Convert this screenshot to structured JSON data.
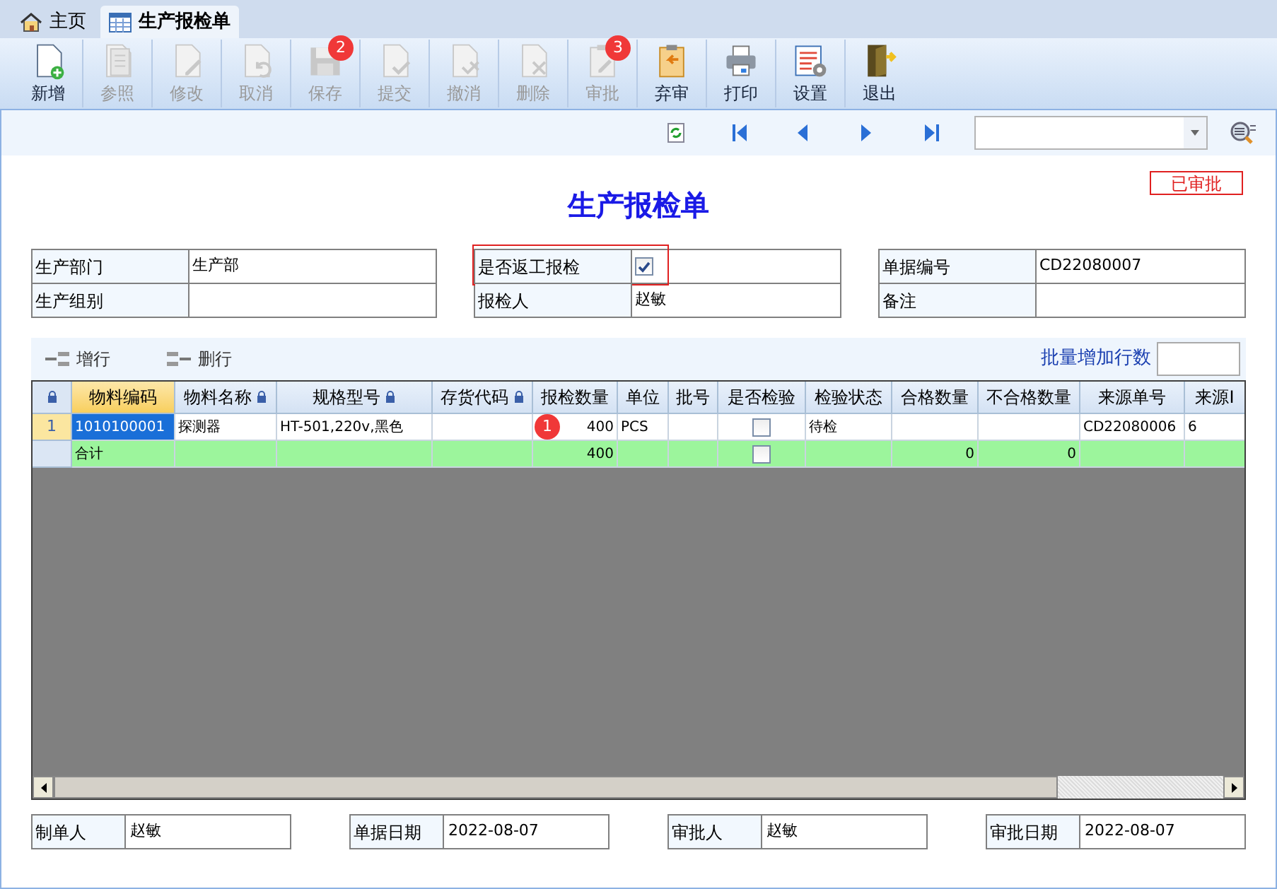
{
  "tabs": [
    {
      "label": "主页",
      "kind": "home",
      "selected": false
    },
    {
      "label": "生产报检单",
      "kind": "table",
      "selected": true
    }
  ],
  "toolbar": [
    {
      "label": "新增",
      "kind": "new",
      "disabled": false
    },
    {
      "label": "参照",
      "kind": "copy",
      "disabled": true
    },
    {
      "label": "修改",
      "kind": "edit",
      "disabled": true
    },
    {
      "label": "取消",
      "kind": "undo",
      "disabled": true
    },
    {
      "label": "保存",
      "kind": "save",
      "disabled": true,
      "badge": "2"
    },
    {
      "label": "提交",
      "kind": "check",
      "disabled": true
    },
    {
      "label": "撤消",
      "kind": "revoke",
      "disabled": true
    },
    {
      "label": "删除",
      "kind": "delete",
      "disabled": true
    },
    {
      "label": "审批",
      "kind": "approve",
      "disabled": true,
      "badge": "3"
    },
    {
      "label": "弃审",
      "kind": "abandon",
      "disabled": false
    },
    {
      "label": "打印",
      "kind": "print",
      "disabled": false
    },
    {
      "label": "设置",
      "kind": "settings",
      "disabled": false
    },
    {
      "label": "退出",
      "kind": "exit",
      "disabled": false
    }
  ],
  "title": "生产报检单",
  "status": "已审批",
  "header_groups": [
    [
      {
        "label": "生产部门",
        "value": "生产部",
        "kind": "text"
      },
      {
        "label": "生产组别",
        "kind": "text"
      }
    ],
    [
      {
        "label": "是否返工报检",
        "kind": "checkbox",
        "checked": true,
        "highlighted": true
      },
      {
        "label": "报检人",
        "value": "赵敏",
        "kind": "text"
      }
    ],
    [
      {
        "label": "单据编号",
        "value": "CD22080007",
        "kind": "text"
      },
      {
        "label": "备注",
        "kind": "text"
      }
    ]
  ],
  "grid_toolbar": {
    "actions": [
      {
        "label": "增行",
        "kind": "add"
      },
      {
        "label": "删行",
        "kind": "remove"
      }
    ],
    "batch_label": "批量增加行数"
  },
  "columns": [
    {
      "locked": true,
      "kind": "indicator"
    },
    {
      "label": "物料编码",
      "locked": false,
      "sorted": true,
      "kind": "text"
    },
    {
      "label": "物料名称",
      "locked": true,
      "sorted": false,
      "kind": "text"
    },
    {
      "label": "规格型号",
      "locked": true,
      "sorted": false,
      "kind": "text"
    },
    {
      "label": "存货代码",
      "locked": true,
      "sorted": false,
      "kind": "text"
    },
    {
      "label": "报检数量",
      "locked": false,
      "sorted": false,
      "kind": "number"
    },
    {
      "label": "单位",
      "locked": false,
      "sorted": false,
      "kind": "text"
    },
    {
      "label": "批号",
      "locked": false,
      "sorted": false,
      "kind": "text"
    },
    {
      "label": "是否检验",
      "locked": false,
      "sorted": false,
      "kind": "check"
    },
    {
      "label": "检验状态",
      "locked": false,
      "sorted": false,
      "kind": "text"
    },
    {
      "label": "合格数量",
      "locked": false,
      "sorted": false,
      "kind": "number"
    },
    {
      "label": "不合格数量",
      "locked": false,
      "sorted": false,
      "kind": "number"
    },
    {
      "label": "来源单号",
      "locked": false,
      "sorted": false,
      "kind": "text"
    },
    {
      "label": "来源I",
      "locked": false,
      "sorted": false,
      "kind": "text"
    }
  ],
  "rows": [
    {
      "kind": "data",
      "selected": true,
      "number": "1",
      "badge": "1",
      "inspected": false,
      "cells": [
        "1010100001",
        "探测器",
        "HT-501,220v,黑色",
        null,
        "400",
        "PCS",
        null,
        null,
        "待检",
        null,
        null,
        "CD22080006",
        "6"
      ]
    },
    {
      "kind": "total",
      "selected": false,
      "inspected": false,
      "cells": [
        "合计",
        null,
        null,
        null,
        "400",
        null,
        null,
        null,
        null,
        "0",
        "0",
        null,
        null
      ]
    }
  ],
  "footer": [
    {
      "label": "制单人",
      "value": "赵敏"
    },
    {
      "label": "单据日期",
      "value": "2022-08-07"
    },
    {
      "label": "审批人",
      "value": "赵敏"
    },
    {
      "label": "审批日期",
      "value": "2022-08-07"
    }
  ]
}
